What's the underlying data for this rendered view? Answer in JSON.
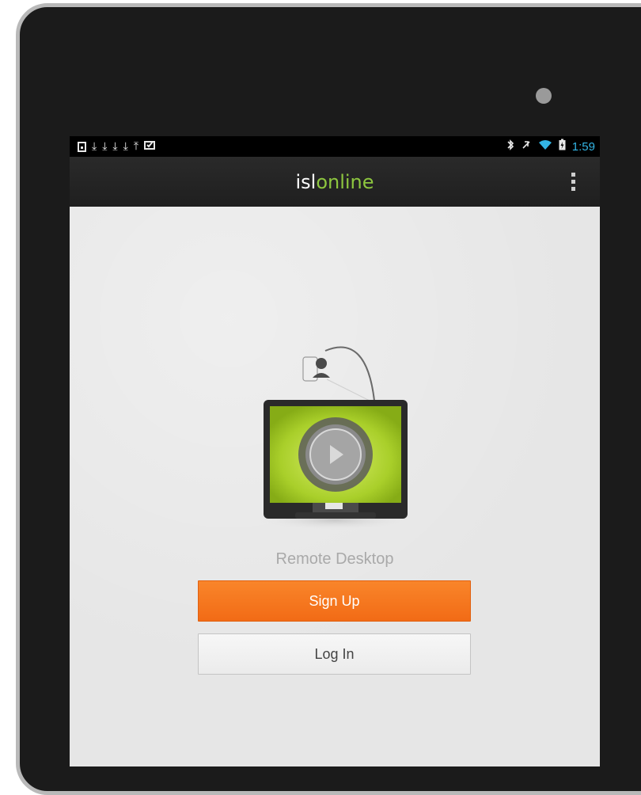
{
  "status_bar": {
    "time": "1:59",
    "left_icons": [
      "notification-box-icon",
      "download-icon",
      "download-icon",
      "download-icon",
      "download-icon",
      "upload-icon",
      "clipboard-check-icon"
    ],
    "right_icons": [
      "bluetooth-icon",
      "muted-icon",
      "wifi-icon",
      "battery-charging-icon"
    ],
    "clock_color": "#33b5e5"
  },
  "action_bar": {
    "logo_part1": "isl",
    "logo_part2": "online",
    "logo_accent": "#8dc63f",
    "menu_icon": "overflow-menu-icon"
  },
  "main": {
    "caption": "Remote Desktop",
    "signup_label": "Sign Up",
    "login_label": "Log In",
    "signup_color": "#f47920"
  }
}
